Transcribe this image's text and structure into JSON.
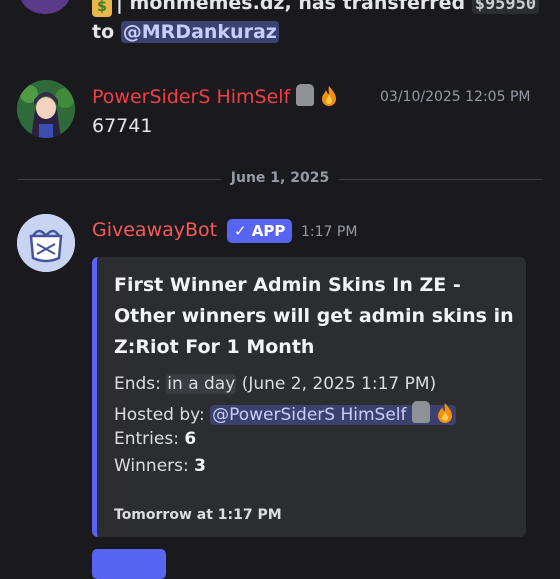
{
  "previous_message": {
    "line1_prefix": "| monmemes.dz, has transferred ",
    "amount": "$95950",
    "line2_prefix": "to ",
    "mention": "@MRDankuraz"
  },
  "message1": {
    "username": "PowerSiderS HimSelf",
    "timestamp": "03/10/2025 12:05 PM",
    "content": "67741"
  },
  "date_divider": "June 1, 2025",
  "message2": {
    "username": "GiveawayBot",
    "badge": "✓ APP",
    "timestamp": "1:17 PM",
    "embed": {
      "title": "First Winner Admin Skins In ZE - Other winners will get admin skins in Z:Riot For 1 Month",
      "ends_label": "Ends: ",
      "ends_relative": "in a day",
      "ends_absolute": " (June 2, 2025 1:17 PM)",
      "hosted_label": "Hosted by: ",
      "hosted_mention": "@PowerSiderS HimSelf",
      "entries_label": "Entries: ",
      "entries_value": "6",
      "winners_label": "Winners: ",
      "winners_value": "3",
      "footer": "Tomorrow at 1:17 PM"
    }
  },
  "colors": {
    "background": "#1a1a1e",
    "accent": "#5865f2",
    "username_red": "#f23f43",
    "mention_bg": "#3c4270"
  }
}
